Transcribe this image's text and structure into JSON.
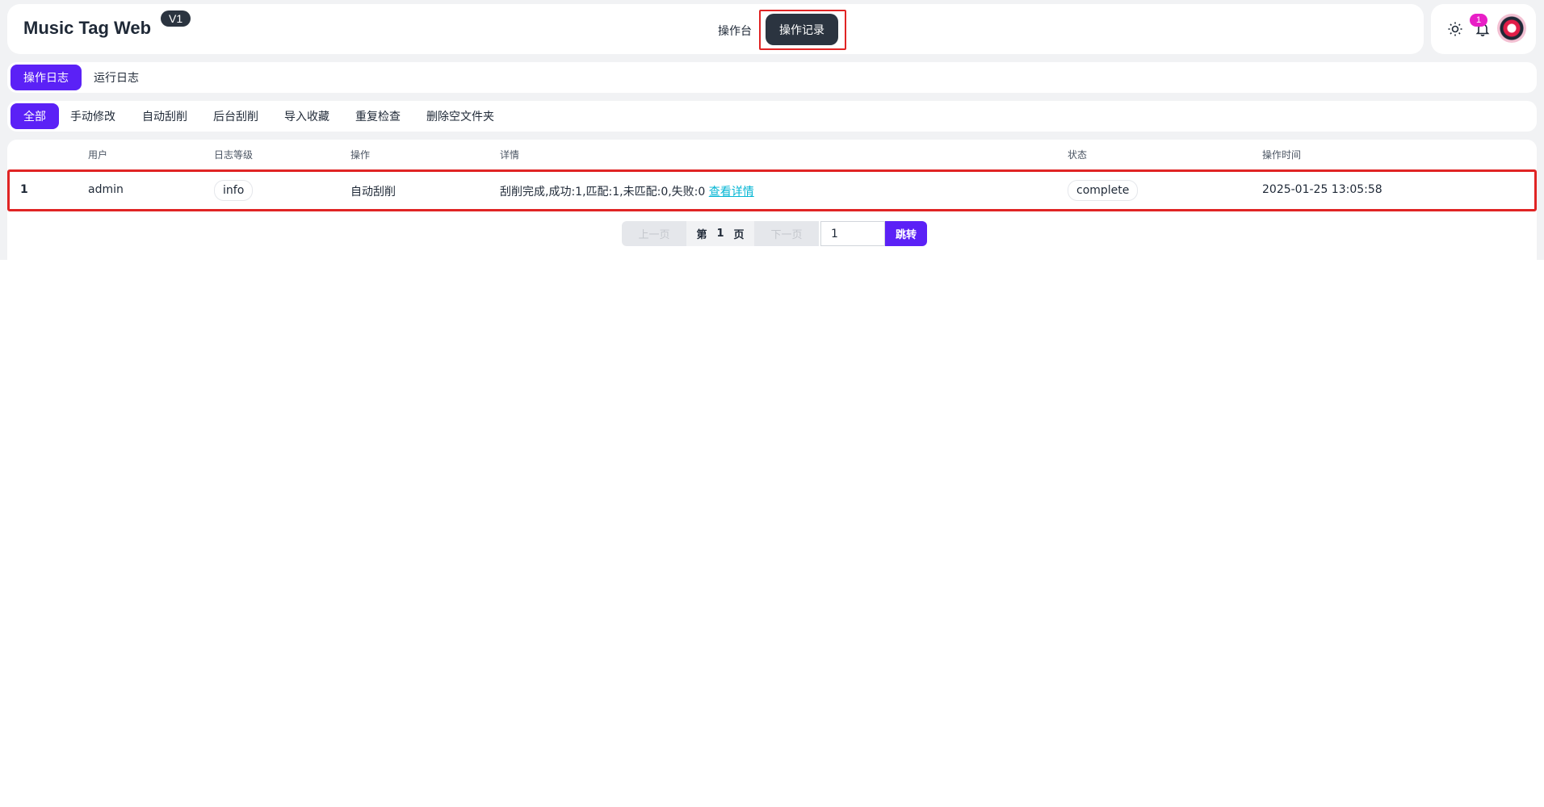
{
  "app": {
    "title": "Music Tag Web",
    "version": "V1"
  },
  "nav": {
    "items": [
      "操作台",
      "操作记录"
    ],
    "active": "操作记录"
  },
  "header_icons": {
    "theme_icon": "sun-icon",
    "bell_icon": "bell-icon",
    "notification_count": "1"
  },
  "log_tabs": {
    "items": [
      "操作日志",
      "运行日志"
    ],
    "active": "操作日志"
  },
  "filter_tabs": {
    "items": [
      "全部",
      "手动修改",
      "自动刮削",
      "后台刮削",
      "导入收藏",
      "重复检查",
      "删除空文件夹"
    ],
    "active": "全部"
  },
  "table": {
    "columns": [
      "用户",
      "日志等级",
      "操作",
      "详情",
      "状态",
      "操作时间"
    ],
    "rows": [
      {
        "index": "1",
        "user": "admin",
        "level": "info",
        "operation": "自动刮削",
        "detail": "刮削完成,成功:1,匹配:1,未匹配:0,失败:0",
        "detail_link": "查看详情",
        "status": "complete",
        "time": "2025-01-25 13:05:58"
      }
    ]
  },
  "pagination": {
    "prev": "上一页",
    "page_prefix": "第",
    "page_number": "1",
    "page_suffix": "页",
    "next": "下一页",
    "input_value": "1",
    "go": "跳转"
  },
  "colors": {
    "primary": "#5b21f6",
    "dark": "#2b3440",
    "highlight": "#e02424",
    "link": "#06b6d4",
    "badge": "#e81fc6"
  }
}
